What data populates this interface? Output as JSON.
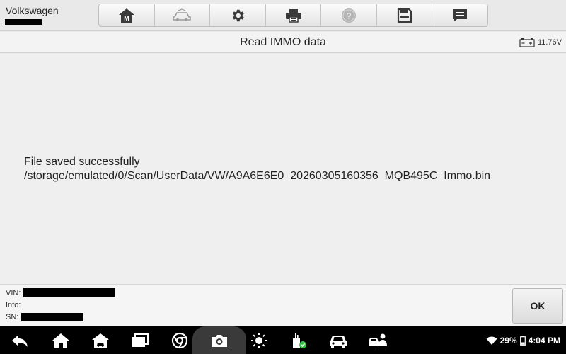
{
  "header": {
    "brand": "Volkswagen",
    "toolbar": [
      {
        "icon": "home-m-icon"
      },
      {
        "icon": "vehicle-swap-icon"
      },
      {
        "icon": "gear-icon"
      },
      {
        "icon": "printer-icon"
      },
      {
        "icon": "help-icon"
      },
      {
        "icon": "save-icon"
      },
      {
        "icon": "message-icon"
      }
    ]
  },
  "titlebar": {
    "title": "Read IMMO data",
    "voltage": "11.76V"
  },
  "content": {
    "line1": "File saved successfully",
    "line2": "/storage/emulated/0/Scan/UserData/VW/A9A6E6E0_20260305160356_MQB495C_Immo.bin"
  },
  "info": {
    "vin_label": "VIN:",
    "info_label": "Info:",
    "sn_label": "SN:",
    "ok_label": "OK"
  },
  "statusbar": {
    "battery": "29%",
    "time": "4:04 PM"
  },
  "colors": {
    "background": "#efefef",
    "navbar": "#000000",
    "toolbar_icon": "#3a3a3a",
    "check_green": "#2ecc40"
  }
}
